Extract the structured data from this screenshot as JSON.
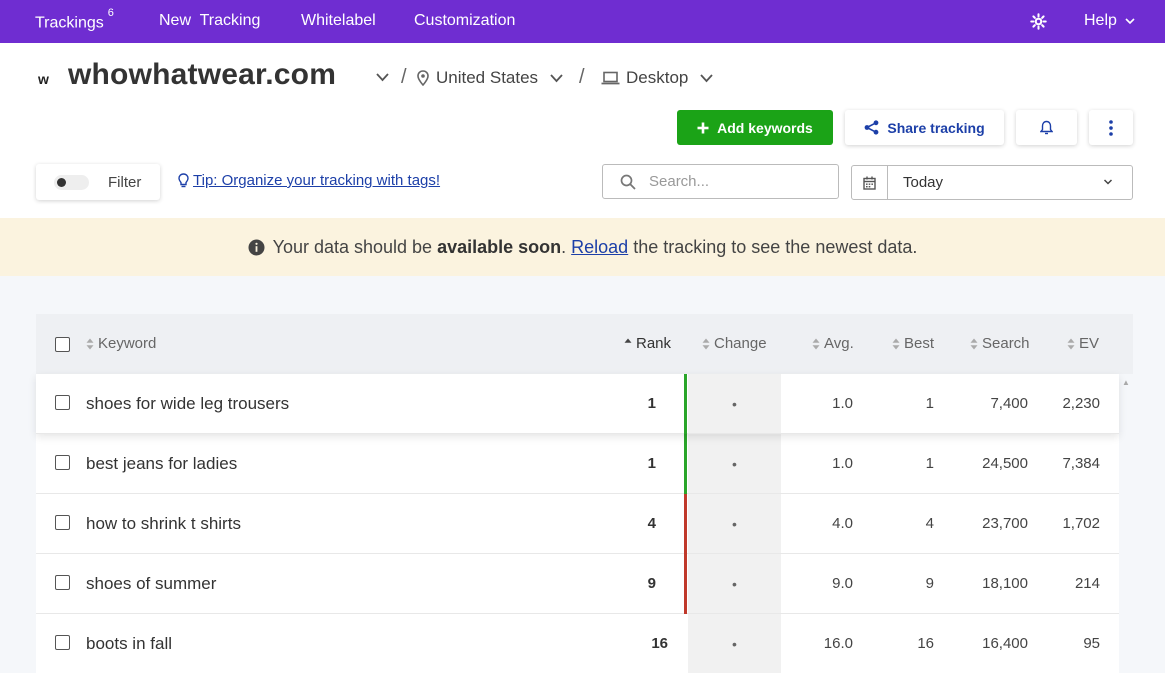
{
  "nav": {
    "trackings_label": "Trackings",
    "trackings_count": "6",
    "new_tracking": "New  Tracking",
    "whitelabel": "Whitelabel",
    "customization": "Customization",
    "help": "Help"
  },
  "header": {
    "logo_letter": "w",
    "domain": "whowhatwear.com",
    "location": "United States",
    "device": "Desktop"
  },
  "actions": {
    "add_keywords": "Add keywords",
    "share_tracking": "Share tracking"
  },
  "filters": {
    "filter_label": "Filter",
    "tip": "Tip: Organize your tracking with tags!",
    "search_placeholder": "Search...",
    "date_value": "Today"
  },
  "banner": {
    "pre": "Your data should be ",
    "bold": "available soon",
    "mid": ". ",
    "link": "Reload",
    "post": " the tracking to see the newest data."
  },
  "table": {
    "columns": {
      "keyword": "Keyword",
      "rank": "Rank",
      "change": "Change",
      "avg": "Avg.",
      "best": "Best",
      "search": "Search",
      "ev": "EV"
    },
    "rows": [
      {
        "keyword": "shoes for wide leg trousers",
        "rank": "1",
        "change": "•",
        "avg": "1.0",
        "best": "1",
        "search": "7,400",
        "ev": "2,230",
        "bar_color": "#2aa52a"
      },
      {
        "keyword": "best jeans for ladies",
        "rank": "1",
        "change": "•",
        "avg": "1.0",
        "best": "1",
        "search": "24,500",
        "ev": "7,384",
        "bar_color": "#2aa52a"
      },
      {
        "keyword": "how to shrink t shirts",
        "rank": "4",
        "change": "•",
        "avg": "4.0",
        "best": "4",
        "search": "23,700",
        "ev": "1,702",
        "bar_color": "#c0392b"
      },
      {
        "keyword": "shoes of summer",
        "rank": "9",
        "change": "•",
        "avg": "9.0",
        "best": "9",
        "search": "18,100",
        "ev": "214",
        "bar_color": "#c0392b"
      },
      {
        "keyword": "boots in fall",
        "rank": "16",
        "change": "•",
        "avg": "16.0",
        "best": "16",
        "search": "16,400",
        "ev": "95",
        "bar_color": ""
      }
    ]
  }
}
